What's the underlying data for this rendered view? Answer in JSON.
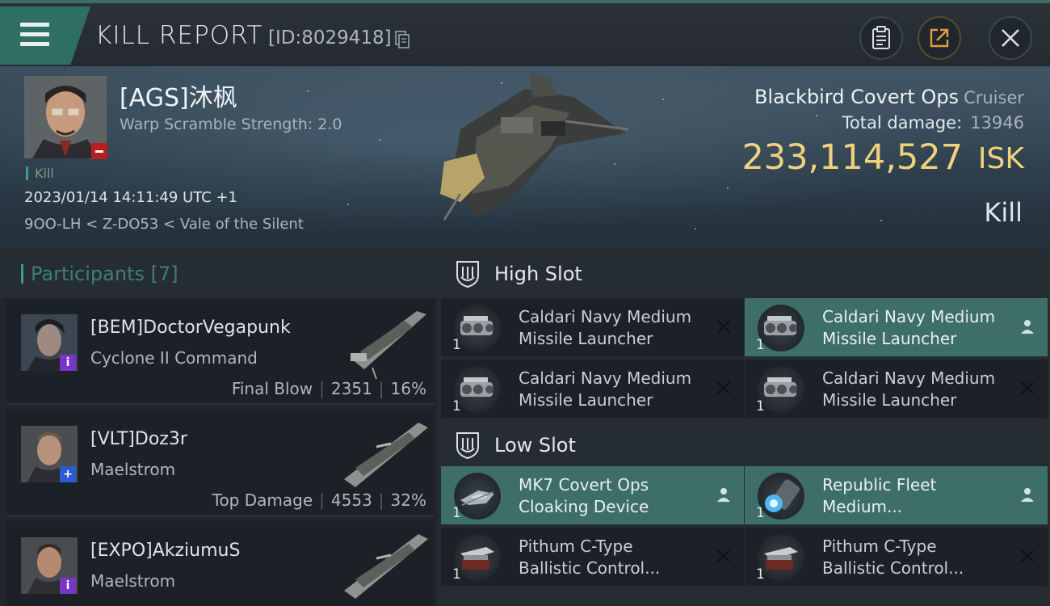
{
  "header": {
    "title": "KILL REPORT",
    "report_id": "[ID:8029418]"
  },
  "victim": {
    "name": "[AGS]沐枫",
    "warp_scramble": "Warp Scramble Strength: 2.0",
    "kill_tag": "Kill",
    "timestamp": "2023/01/14 14:11:49 UTC +1",
    "location": "9OO-LH < Z-DO53 < Vale of the Silent",
    "ship_name": "Blackbird Covert Ops",
    "ship_class": "Cruiser",
    "total_damage_label": "Total damage:",
    "total_damage": "13946",
    "isk_value": "233,114,527",
    "isk_label": "ISK",
    "result": "Kill"
  },
  "participants": {
    "label": "Participants [7]",
    "items": [
      {
        "name": "[BEM]DoctorVegapunk",
        "ship": "Cyclone II Command",
        "role": "Final Blow",
        "damage": "2351",
        "percent": "16%",
        "badge": "purple"
      },
      {
        "name": "[VLT]Doz3r",
        "ship": "Maelstrom",
        "role": "Top Damage",
        "damage": "4553",
        "percent": "32%",
        "badge": "blue"
      },
      {
        "name": "[EXPO]AkziumuS",
        "ship": "Maelstrom",
        "role": "",
        "damage": "",
        "percent": "",
        "badge": "purple"
      }
    ]
  },
  "fitting": {
    "high_slot": {
      "label": "High Slot",
      "modules": [
        {
          "line1": "Caldari Navy Medium",
          "line2": "Missile Launcher",
          "qty": "1",
          "status": "destroyed"
        },
        {
          "line1": "Caldari Navy Medium",
          "line2": "Missile Launcher",
          "qty": "1",
          "status": "dropped"
        },
        {
          "line1": "Caldari Navy Medium",
          "line2": "Missile Launcher",
          "qty": "1",
          "status": "destroyed"
        },
        {
          "line1": "Caldari Navy Medium",
          "line2": "Missile Launcher",
          "qty": "1",
          "status": "destroyed"
        }
      ]
    },
    "low_slot": {
      "label": "Low Slot",
      "modules": [
        {
          "line1": "MK7 Covert Ops",
          "line2": "Cloaking Device",
          "qty": "1",
          "status": "dropped"
        },
        {
          "line1": "Republic Fleet",
          "line2": "Medium...",
          "qty": "1",
          "status": "dropped"
        },
        {
          "line1": "Pithum C-Type",
          "line2": "Ballistic Control...",
          "qty": "1",
          "status": "destroyed"
        },
        {
          "line1": "Pithum C-Type",
          "line2": "Ballistic Control...",
          "qty": "1",
          "status": "destroyed"
        }
      ]
    }
  },
  "colors": {
    "accent_teal": "#3e6e68",
    "isk_gold": "#f0d27d",
    "minus_red": "#b51f1f"
  }
}
